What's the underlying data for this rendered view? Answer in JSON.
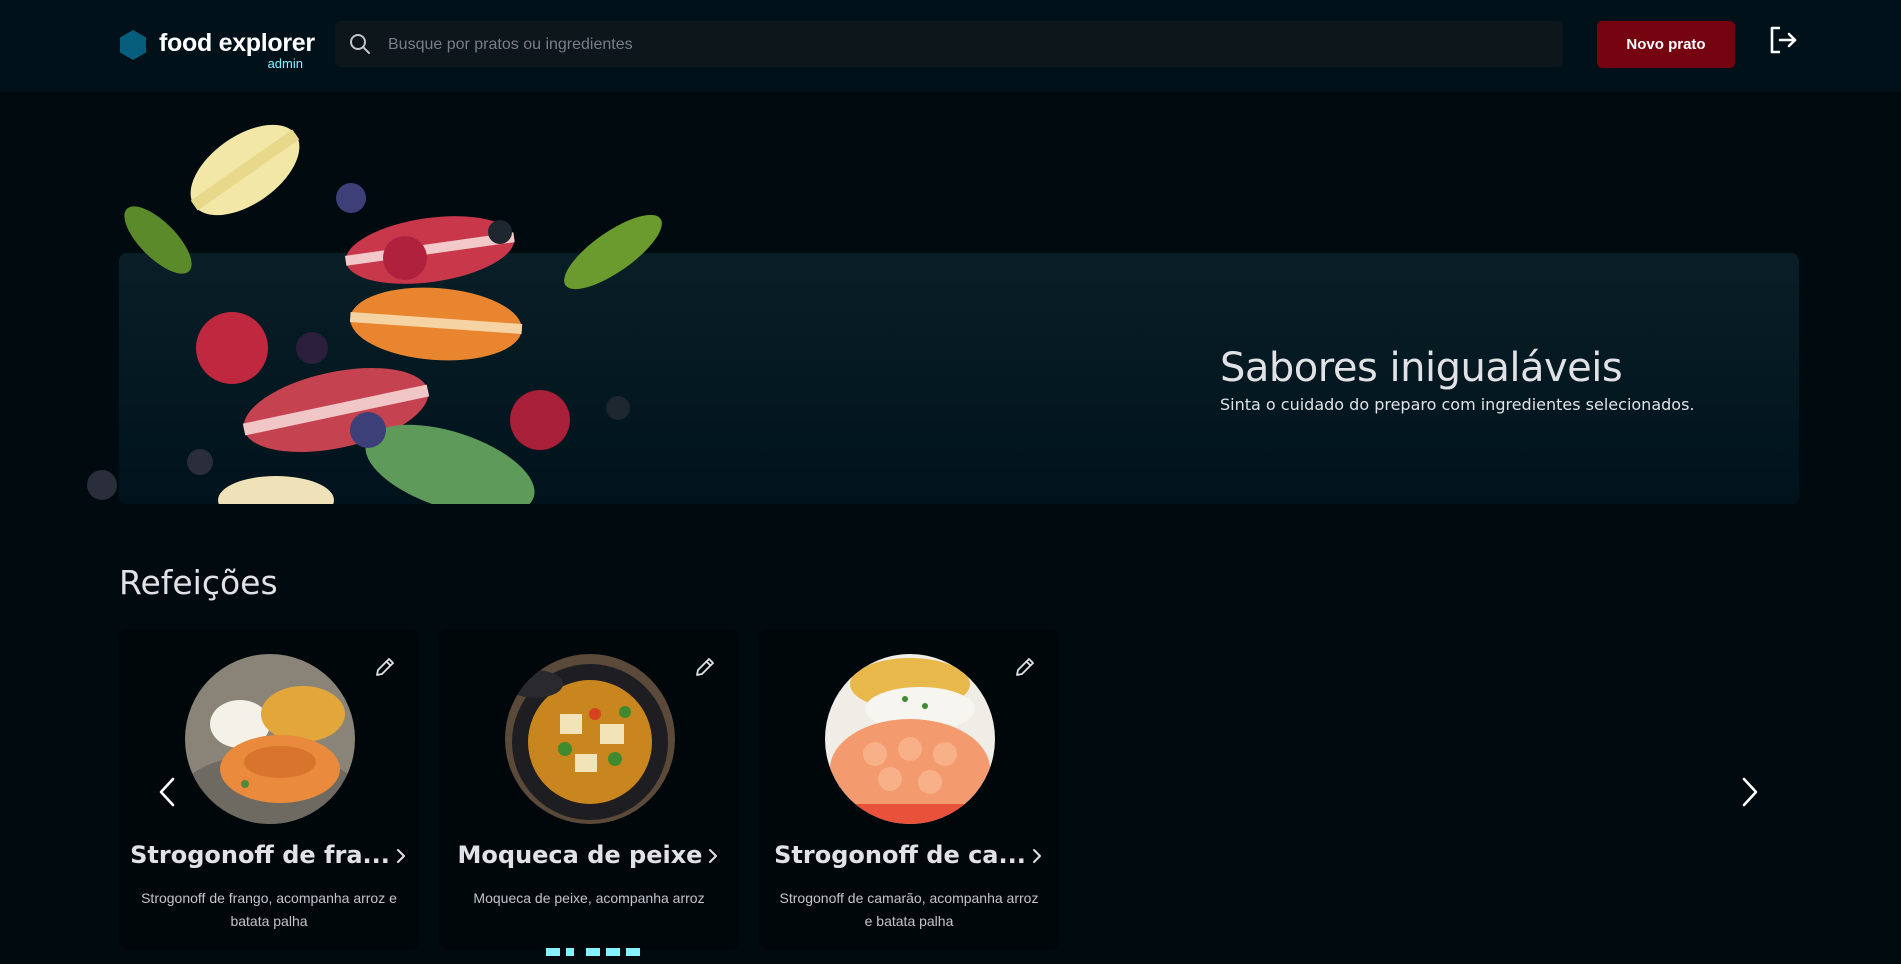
{
  "header": {
    "brand_name": "food explorer",
    "brand_role": "admin",
    "search_placeholder": "Busque por pratos ou ingredientes",
    "new_dish_label": "Novo prato"
  },
  "banner": {
    "title": "Sabores inigualáveis",
    "subtitle": "Sinta o cuidado do preparo com ingredientes selecionados."
  },
  "section": {
    "title": "Refeições"
  },
  "dishes": [
    {
      "name": "Strogonoff de fra...",
      "description": "Strogonoff de frango, acompanha arroz e batata palha"
    },
    {
      "name": "Moqueca de peixe",
      "description": "Moqueca de peixe, acompanha arroz"
    },
    {
      "name": "Strogonoff de ca...",
      "description": "Strogonoff de camarão, acompanha arroz e batata palha"
    }
  ],
  "icons": {
    "brand": "hexagon-logo-icon",
    "search": "search-icon",
    "logout": "sign-out-icon",
    "edit": "pencil-icon",
    "card_link": "chevron-right-icon",
    "carousel_prev": "chevron-left-icon",
    "carousel_next": "chevron-right-icon"
  },
  "colors": {
    "page_background": "#000A0F",
    "header_background": "#00111A",
    "brand_accent": "#065E7C",
    "admin_label": "#82F3FF",
    "primary_button": "#750310",
    "text": "#E1E1E6"
  }
}
